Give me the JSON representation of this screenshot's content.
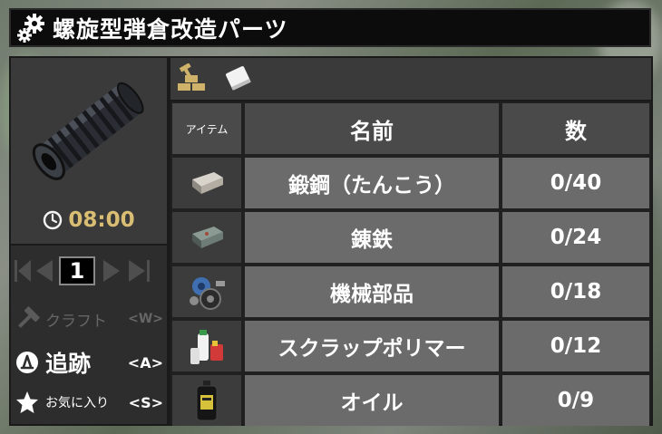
{
  "window": {
    "title": "螺旋型弾倉改造パーツ"
  },
  "recipe": {
    "craft_time": "08:00",
    "quantity": "1"
  },
  "actions": [
    {
      "label": "クラフト",
      "key": "<W>"
    },
    {
      "label": "追跡",
      "key": "<A>"
    },
    {
      "label": "お気に入り",
      "key": "<S>"
    }
  ],
  "table": {
    "headers": {
      "item": "アイテム",
      "name": "名前",
      "count": "数"
    },
    "rows": [
      {
        "icon": "forged-steel-icon",
        "name": "鍛鋼（たんこう）",
        "count": "0/40"
      },
      {
        "icon": "forged-iron-icon",
        "name": "錬鉄",
        "count": "0/24"
      },
      {
        "icon": "mechanical-parts-icon",
        "name": "機械部品",
        "count": "0/18"
      },
      {
        "icon": "scrap-polymers-icon",
        "name": "スクラップポリマー",
        "count": "0/12"
      },
      {
        "icon": "oil-icon",
        "name": "オイル",
        "count": "0/9"
      }
    ]
  },
  "colors": {
    "craft_time": "#d8bd73",
    "header_bg": "#4a4a4a",
    "row_bg": "#6b6b6b",
    "icon_cell_bg": "#3c3c3c"
  }
}
